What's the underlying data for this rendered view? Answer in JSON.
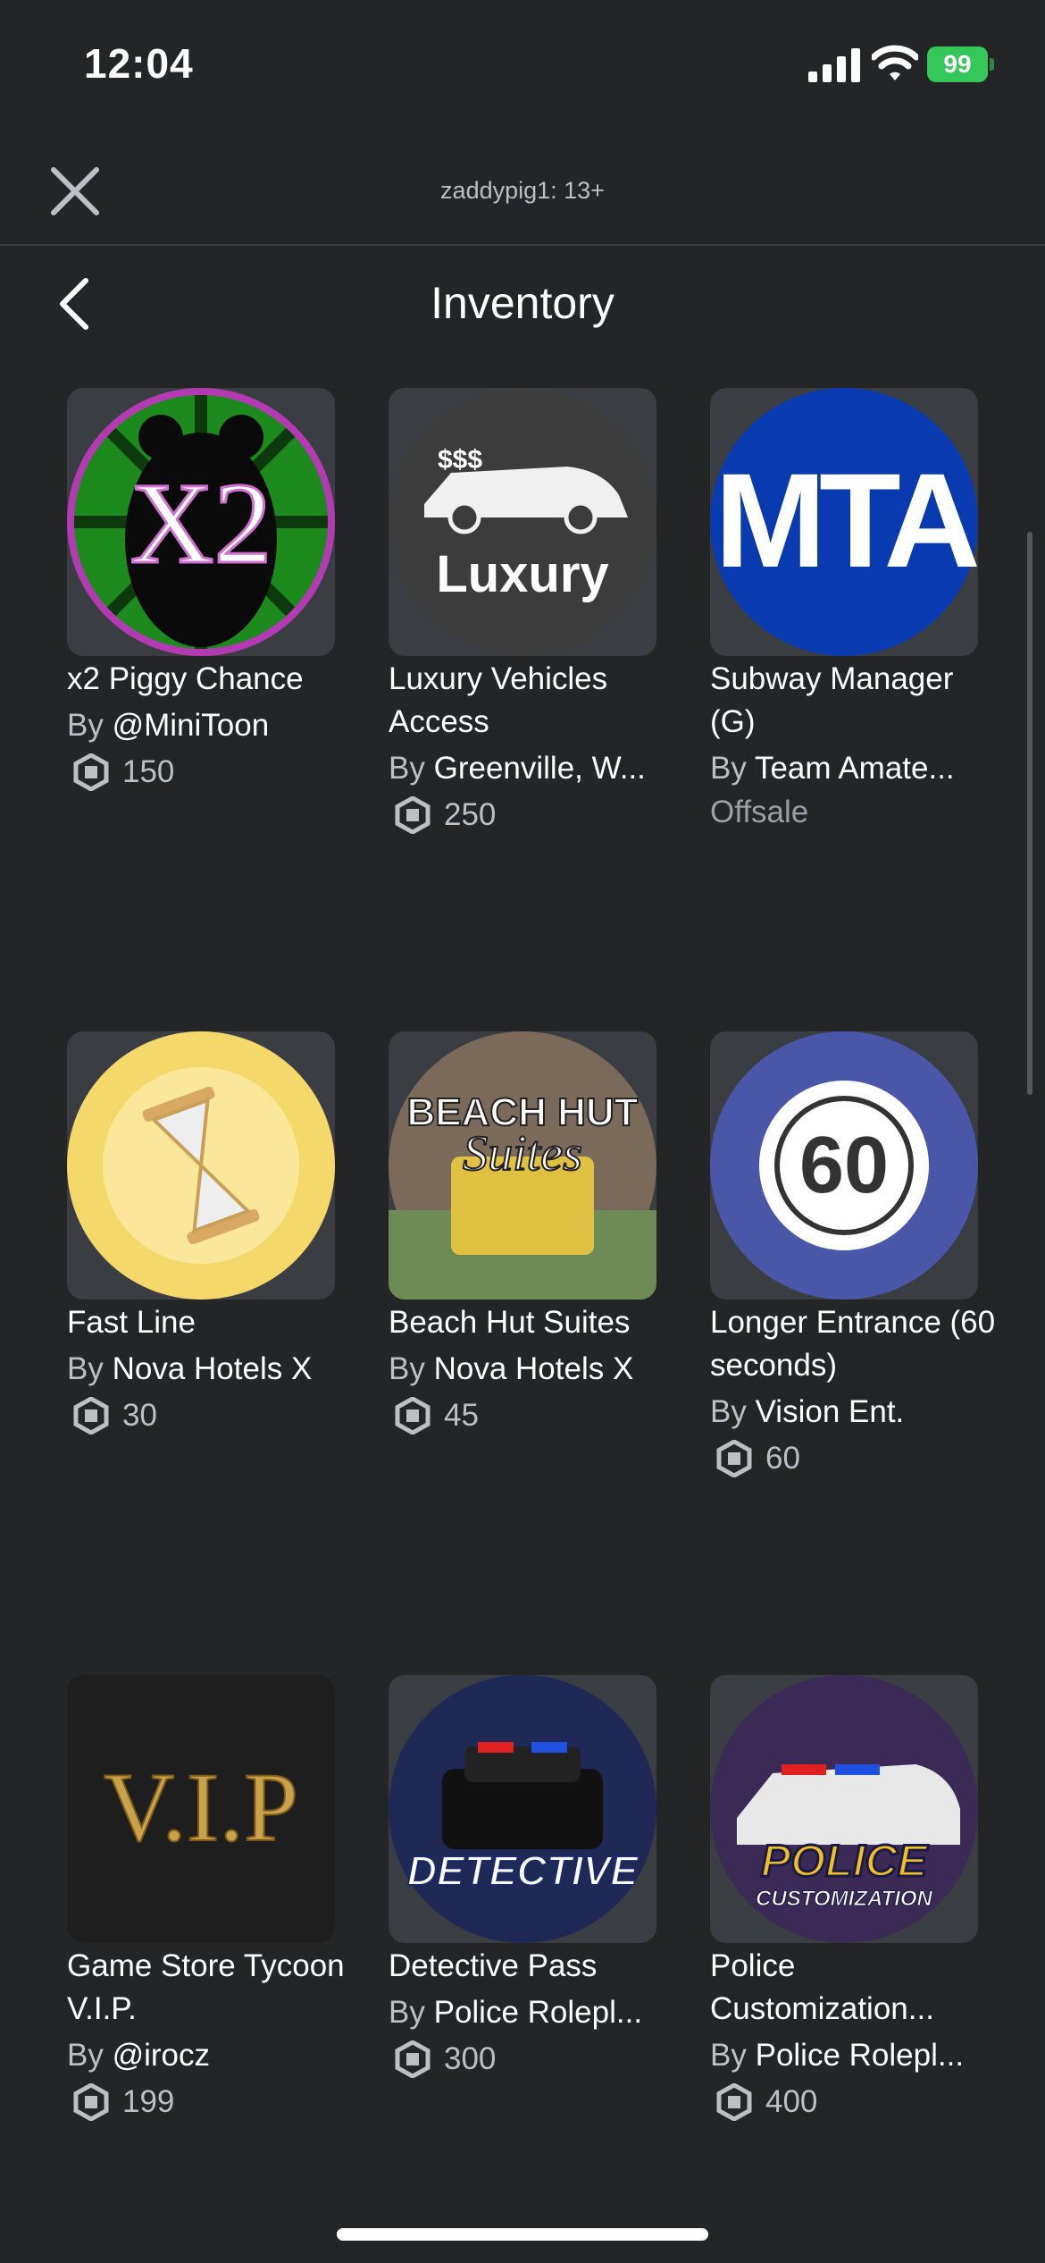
{
  "status_bar": {
    "time": "12:04",
    "battery": "99"
  },
  "header": {
    "title": "zaddypig1: 13+"
  },
  "page": {
    "title": "Inventory"
  },
  "items": [
    {
      "name": "x2 Piggy Chance",
      "by": "By",
      "creator": "@MiniToon",
      "price": "150",
      "thumb_text": "X2"
    },
    {
      "name": "Luxury Vehicles Access",
      "by": "By",
      "creator": "Greenville, W...",
      "price": "250",
      "thumb_text": "Luxury",
      "thumb_sub": "$$$"
    },
    {
      "name": "Subway Manager (G)",
      "by": "By",
      "creator": "Team Amate...",
      "status": "Offsale",
      "thumb_text": "MTA"
    },
    {
      "name": "Fast Line",
      "by": "By",
      "creator": "Nova Hotels X",
      "price": "30"
    },
    {
      "name": "Beach Hut Suites",
      "by": "By",
      "creator": "Nova Hotels X",
      "price": "45",
      "thumb_text": "BEACH HUT",
      "thumb_sub": "Suites"
    },
    {
      "name": "Longer Entrance (60 seconds)",
      "by": "By",
      "creator": "Vision Ent.",
      "price": "60",
      "thumb_text": "60"
    },
    {
      "name": "Game Store Tycoon V.I.P.",
      "by": "By",
      "creator": "@irocz",
      "price": "199",
      "thumb_text": "V.I.P"
    },
    {
      "name": "Detective Pass",
      "by": "By",
      "creator": "Police Rolepl...",
      "price": "300",
      "thumb_text": "DETECTIVE"
    },
    {
      "name": "Police Customization...",
      "by": "By",
      "creator": "Police Rolepl...",
      "price": "400",
      "thumb_text": "POLICE",
      "thumb_sub": "CUSTOMIZATION"
    }
  ],
  "icons": {
    "close": "close-icon",
    "back": "chevron-left-icon",
    "currency": "robux-icon"
  },
  "colors": {
    "background": "#232527",
    "text_secondary": "#bcbfc3",
    "battery": "#35c759"
  }
}
